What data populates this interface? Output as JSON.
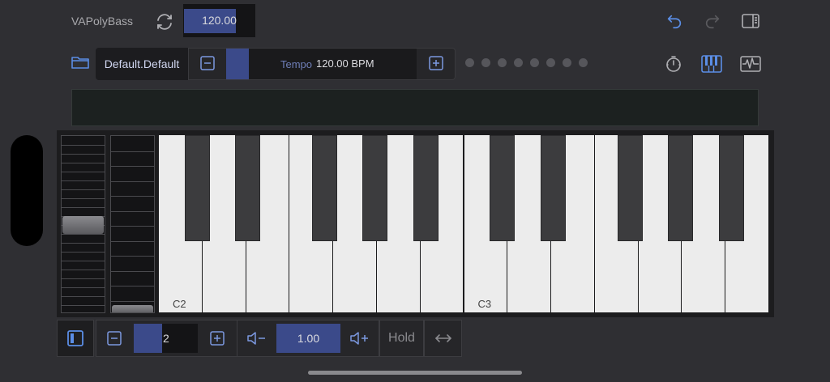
{
  "app": {
    "title": "VAPolyBass"
  },
  "top_tempo": {
    "value": "120.00"
  },
  "preset": {
    "name": "Default.Default"
  },
  "tempo": {
    "label": "Tempo",
    "value": "120.00 BPM"
  },
  "keyboard": {
    "labels": [
      "C2",
      "C3"
    ]
  },
  "octave": {
    "value": "2"
  },
  "velocity": {
    "value": "1.00"
  },
  "hold": {
    "label": "Hold"
  },
  "colors": {
    "accent": "#3b4a8a",
    "icon_blue": "#5b8ee6",
    "bg": "#2f2f33"
  },
  "icons": [
    "sync-icon",
    "undo-icon",
    "redo-icon",
    "panel-icon",
    "folder-icon",
    "minus-icon",
    "plus-icon",
    "clock-icon",
    "piano-keys-icon",
    "waveform-icon",
    "layout-icon",
    "volume-down-icon",
    "volume-up-icon",
    "swap-arrows-icon"
  ]
}
